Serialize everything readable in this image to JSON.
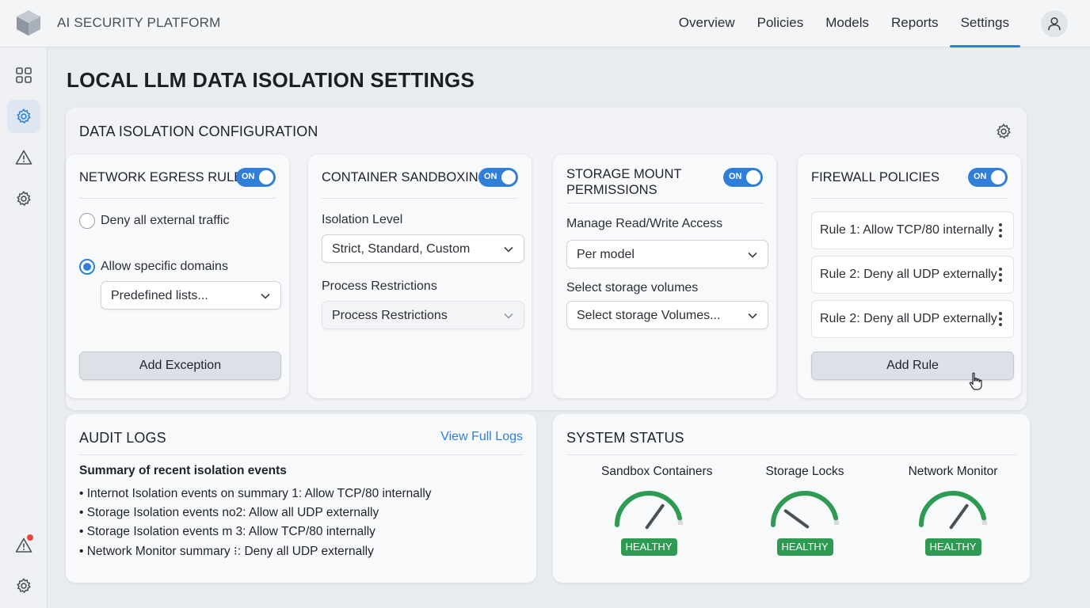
{
  "header": {
    "brand": "AI SECURITY PLATFORM",
    "nav": [
      "Overview",
      "Policies",
      "Models",
      "Reports",
      "Settings"
    ],
    "active_nav": "Settings"
  },
  "page": {
    "title": "LOCAL LLM DATA ISOLATION SETTINGS"
  },
  "config": {
    "title": "DATA ISOLATION CONFIGURATION",
    "network": {
      "title": "NETWORK EGRESS RULES",
      "toggle": "ON",
      "option_deny": "Deny all external traffic",
      "option_allow": "Allow specific domains",
      "domains_select": "Predefined lists...",
      "add_exception": "Add Exception"
    },
    "sandbox": {
      "title": "CONTAINER SANDBOXING",
      "toggle": "ON",
      "isolation_label": "Isolation Level",
      "isolation_select": "Strict, Standard, Custom",
      "process_label": "Process Restrictions",
      "process_select": "Process Restrictions"
    },
    "storage": {
      "title_line1": "STORAGE MOUNT",
      "title_line2": "PERMISSIONS",
      "toggle": "ON",
      "access_label": "Manage Read/Write Access",
      "access_select": "Per model",
      "volumes_label": "Select storage volumes",
      "volumes_select": "Select storage Volumes..."
    },
    "firewall": {
      "title": "FIREWALL POLICIES",
      "toggle": "ON",
      "rules": [
        "Rule 1: Allow TCP/80 internally",
        "Rule 2: Deny all UDP externally",
        "Rule 2: Deny all UDP externally"
      ],
      "add_rule": "Add Rule"
    }
  },
  "audit": {
    "title": "AUDIT LOGS",
    "view_link": "View Full Logs",
    "summary_title": "Summary of recent isolation events",
    "events": [
      "• Internot Isolation events on summary 1: Allow TCP/80 internally",
      "• Storage Isolation events no2: Allow all UDP externally",
      "• Storage Isolation events m 3: Allow TCP/80 internally",
      "• Network Monitor summary ⁝: Deny all UDP externally"
    ]
  },
  "status": {
    "title": "SYSTEM STATUS",
    "gauges": [
      {
        "name": "Sandbox Containers",
        "status": "HEALTHY",
        "level": 0.7
      },
      {
        "name": "Storage Locks",
        "status": "HEALTHY",
        "level": 0.2
      },
      {
        "name": "Network Monitor",
        "status": "HEALTHY",
        "level": 0.7
      }
    ]
  },
  "colors": {
    "accent": "#2f7fd8",
    "healthy": "#2e9a52",
    "gauge_track": "#d7dbe0",
    "alert": "#e5483b"
  }
}
